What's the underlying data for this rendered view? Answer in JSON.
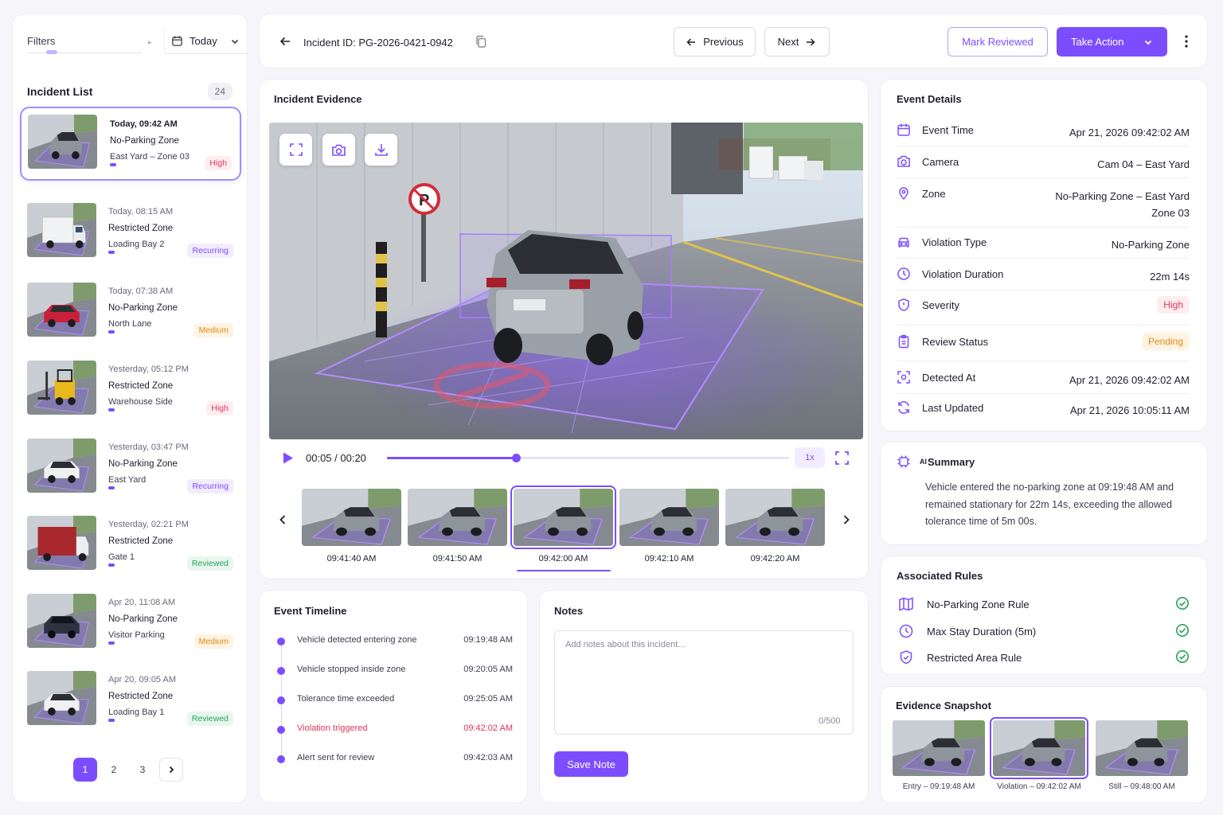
{
  "filters": {
    "label": "Filters",
    "date": "Today"
  },
  "incident_list": {
    "title": "Incident List",
    "count": "24",
    "items": [
      {
        "time": "Today, 09:42 AM",
        "type": "No-Parking Zone",
        "location": "East Yard – Zone 03",
        "badge": "High",
        "vehicle": "suv"
      },
      {
        "time": "Today, 08:15 AM",
        "type": "Restricted Zone",
        "location": "Loading Bay 2",
        "badge": "Recurring",
        "vehicle": "truck"
      },
      {
        "time": "Today, 07:38 AM",
        "type": "No-Parking Zone",
        "location": "North Lane",
        "badge": "Medium",
        "vehicle": "redcar"
      },
      {
        "time": "Yesterday, 05:12 PM",
        "type": "Restricted Zone",
        "location": "Warehouse Side",
        "badge": "High",
        "vehicle": "forklift"
      },
      {
        "time": "Yesterday, 03:47 PM",
        "type": "No-Parking Zone",
        "location": "East Yard",
        "badge": "Recurring",
        "vehicle": "whitecar"
      },
      {
        "time": "Yesterday, 02:21 PM",
        "type": "Restricted Zone",
        "location": "Gate 1",
        "badge": "Reviewed",
        "vehicle": "redtruck"
      },
      {
        "time": "Apr 20, 11:08 AM",
        "type": "No-Parking Zone",
        "location": "Visitor Parking",
        "badge": "Medium",
        "vehicle": "darkcar"
      },
      {
        "time": "Apr 20, 09:05 AM",
        "type": "Restricted Zone",
        "location": "Loading Bay 1",
        "badge": "Reviewed",
        "vehicle": "whitecar"
      }
    ]
  },
  "pagination": {
    "pages": [
      "1",
      "2",
      "3"
    ],
    "current": "1"
  },
  "topbar": {
    "incident_id": "Incident ID: PG-2026-0421-0942",
    "previous": "Previous",
    "next": "Next",
    "mark_reviewed": "Mark Reviewed",
    "take_action": "Take Action"
  },
  "evidence": {
    "title": "Incident Evidence",
    "time": "00:05 / 00:20",
    "progress": 0.32,
    "speed": "1x",
    "frames": [
      "09:41:40 AM",
      "09:41:50 AM",
      "09:42:00 AM",
      "09:42:10 AM",
      "09:42:20 AM"
    ],
    "selected_frame": 2
  },
  "timeline": {
    "title": "Event Timeline",
    "events": [
      {
        "text": "Vehicle detected entering zone",
        "time": "09:19:48 AM"
      },
      {
        "text": "Vehicle stopped inside zone",
        "time": "09:20:05 AM"
      },
      {
        "text": "Tolerance time exceeded",
        "time": "09:25:05 AM"
      },
      {
        "text": "Violation triggered",
        "time": "09:42:02 AM"
      },
      {
        "text": "Alert sent for review",
        "time": "09:42:03 AM"
      }
    ]
  },
  "notes": {
    "title": "Notes",
    "placeholder": "Add notes about this incident...",
    "count": "0/500",
    "save": "Save Note"
  },
  "details": {
    "title": "Event Details",
    "rows": [
      {
        "label": "Event Time",
        "value": "Apr 21, 2026 09:42:02 AM"
      },
      {
        "label": "Camera",
        "value": "Cam 04 – East Yard"
      },
      {
        "label": "Zone",
        "value": "No-Parking Zone – East Yard",
        "value2": "Zone 03"
      },
      {
        "label": "Violation Type",
        "value": "No-Parking Zone"
      },
      {
        "label": "Violation Duration",
        "value": "22m 14s"
      },
      {
        "label": "Severity",
        "value": "High"
      },
      {
        "label": "Review Status",
        "value": "Pending"
      },
      {
        "label": "Detected At",
        "value": "Apr 21, 2026 09:42:02 AM"
      },
      {
        "label": "Last Updated",
        "value": "Apr 21, 2026 10:05:11 AM"
      }
    ]
  },
  "summary": {
    "ai_tag": "AI",
    "title": "Summary",
    "text": "Vehicle entered the no-parking zone at 09:19:48 AM and remained stationary for 22m 14s, exceeding the allowed tolerance time of 5m 00s."
  },
  "rules": {
    "title": "Associated Rules",
    "items": [
      "No-Parking Zone Rule",
      "Max Stay Duration (5m)",
      "Restricted Area Rule"
    ]
  },
  "snapshot": {
    "title": "Evidence Snapshot",
    "items": [
      "Entry – 09:19:48 AM",
      "Violation – 09:42:02 AM",
      "Still – 09:48:00 AM"
    ]
  },
  "colors": {
    "accent": "#7c4dff",
    "high": "#e0355a",
    "medium": "#e08a17",
    "reviewed": "#27a35a"
  }
}
